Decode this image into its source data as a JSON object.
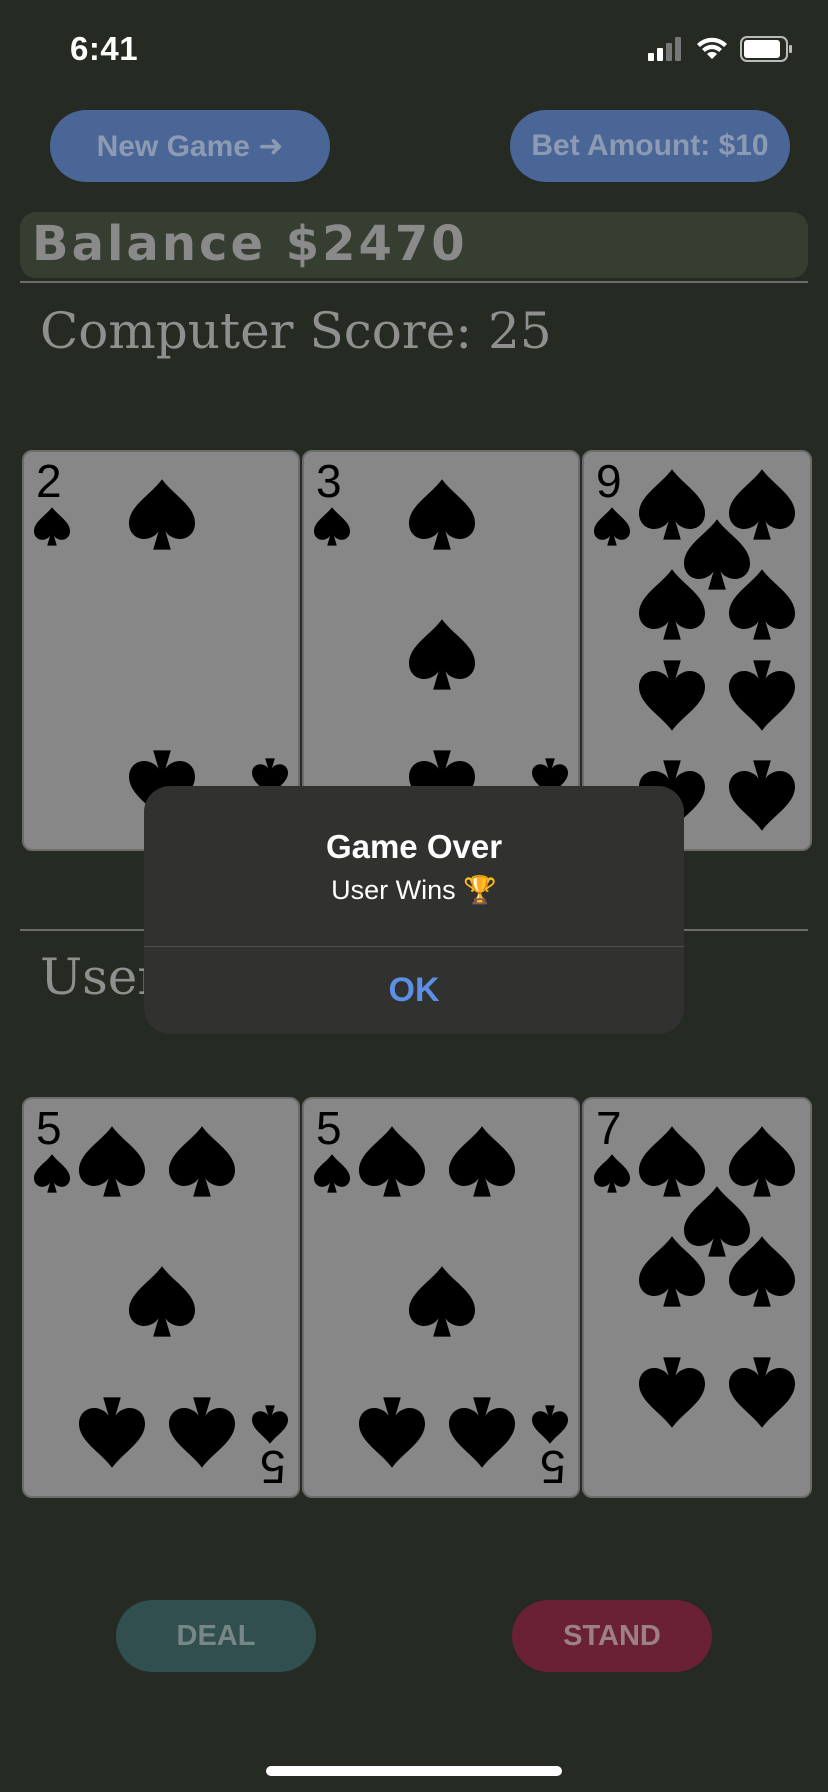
{
  "status": {
    "time": "6:41"
  },
  "header": {
    "new_game_label": "New Game ➜",
    "bet_label": "Bet Amount: $10"
  },
  "balance": {
    "text": "Balance $2470"
  },
  "computer": {
    "score_text": "Computer Score: 25",
    "cards": [
      {
        "rank": "2",
        "suit": "spades"
      },
      {
        "rank": "3",
        "suit": "spades"
      },
      {
        "rank": "9",
        "suit": "spades"
      }
    ]
  },
  "user": {
    "score_text": "User",
    "cards": [
      {
        "rank": "5",
        "suit": "spades"
      },
      {
        "rank": "5",
        "suit": "spades"
      },
      {
        "rank": "7",
        "suit": "spades"
      }
    ]
  },
  "actions": {
    "deal_label": "DEAL",
    "stand_label": "STAND"
  },
  "alert": {
    "title": "Game Over",
    "message": "User Wins 🏆",
    "ok_label": "OK"
  },
  "colors": {
    "background": "#252a22",
    "blue_button": "#4a6697",
    "deal_button": "#304f4e",
    "stand_button": "#6a2035",
    "alert_link": "#5c8fe6"
  }
}
